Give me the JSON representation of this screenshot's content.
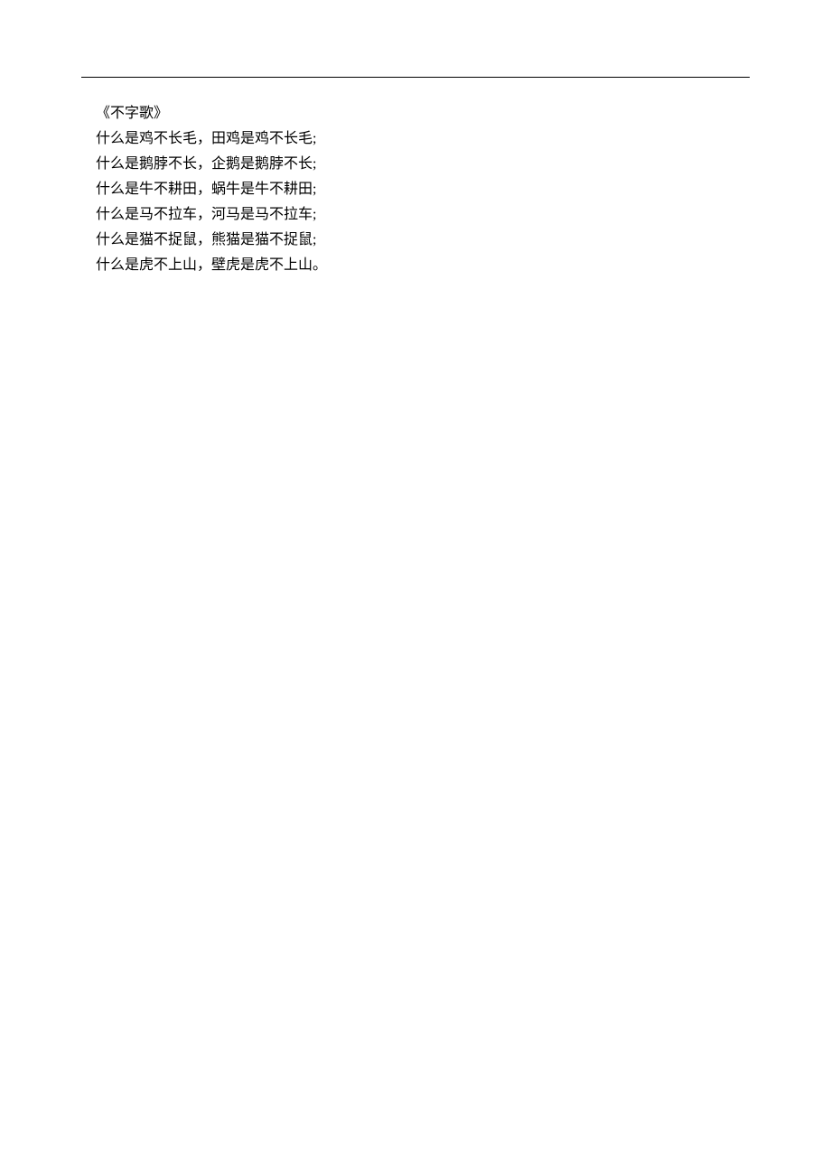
{
  "title": "《不字歌》",
  "verses": [
    "什么是鸡不长毛，田鸡是鸡不长毛;",
    "什么是鹅脖不长，企鹅是鹅脖不长;",
    "什么是牛不耕田，蜗牛是牛不耕田;",
    "什么是马不拉车，河马是马不拉车;",
    "什么是猫不捉鼠，熊猫是猫不捉鼠;",
    "什么是虎不上山，壁虎是虎不上山。"
  ]
}
